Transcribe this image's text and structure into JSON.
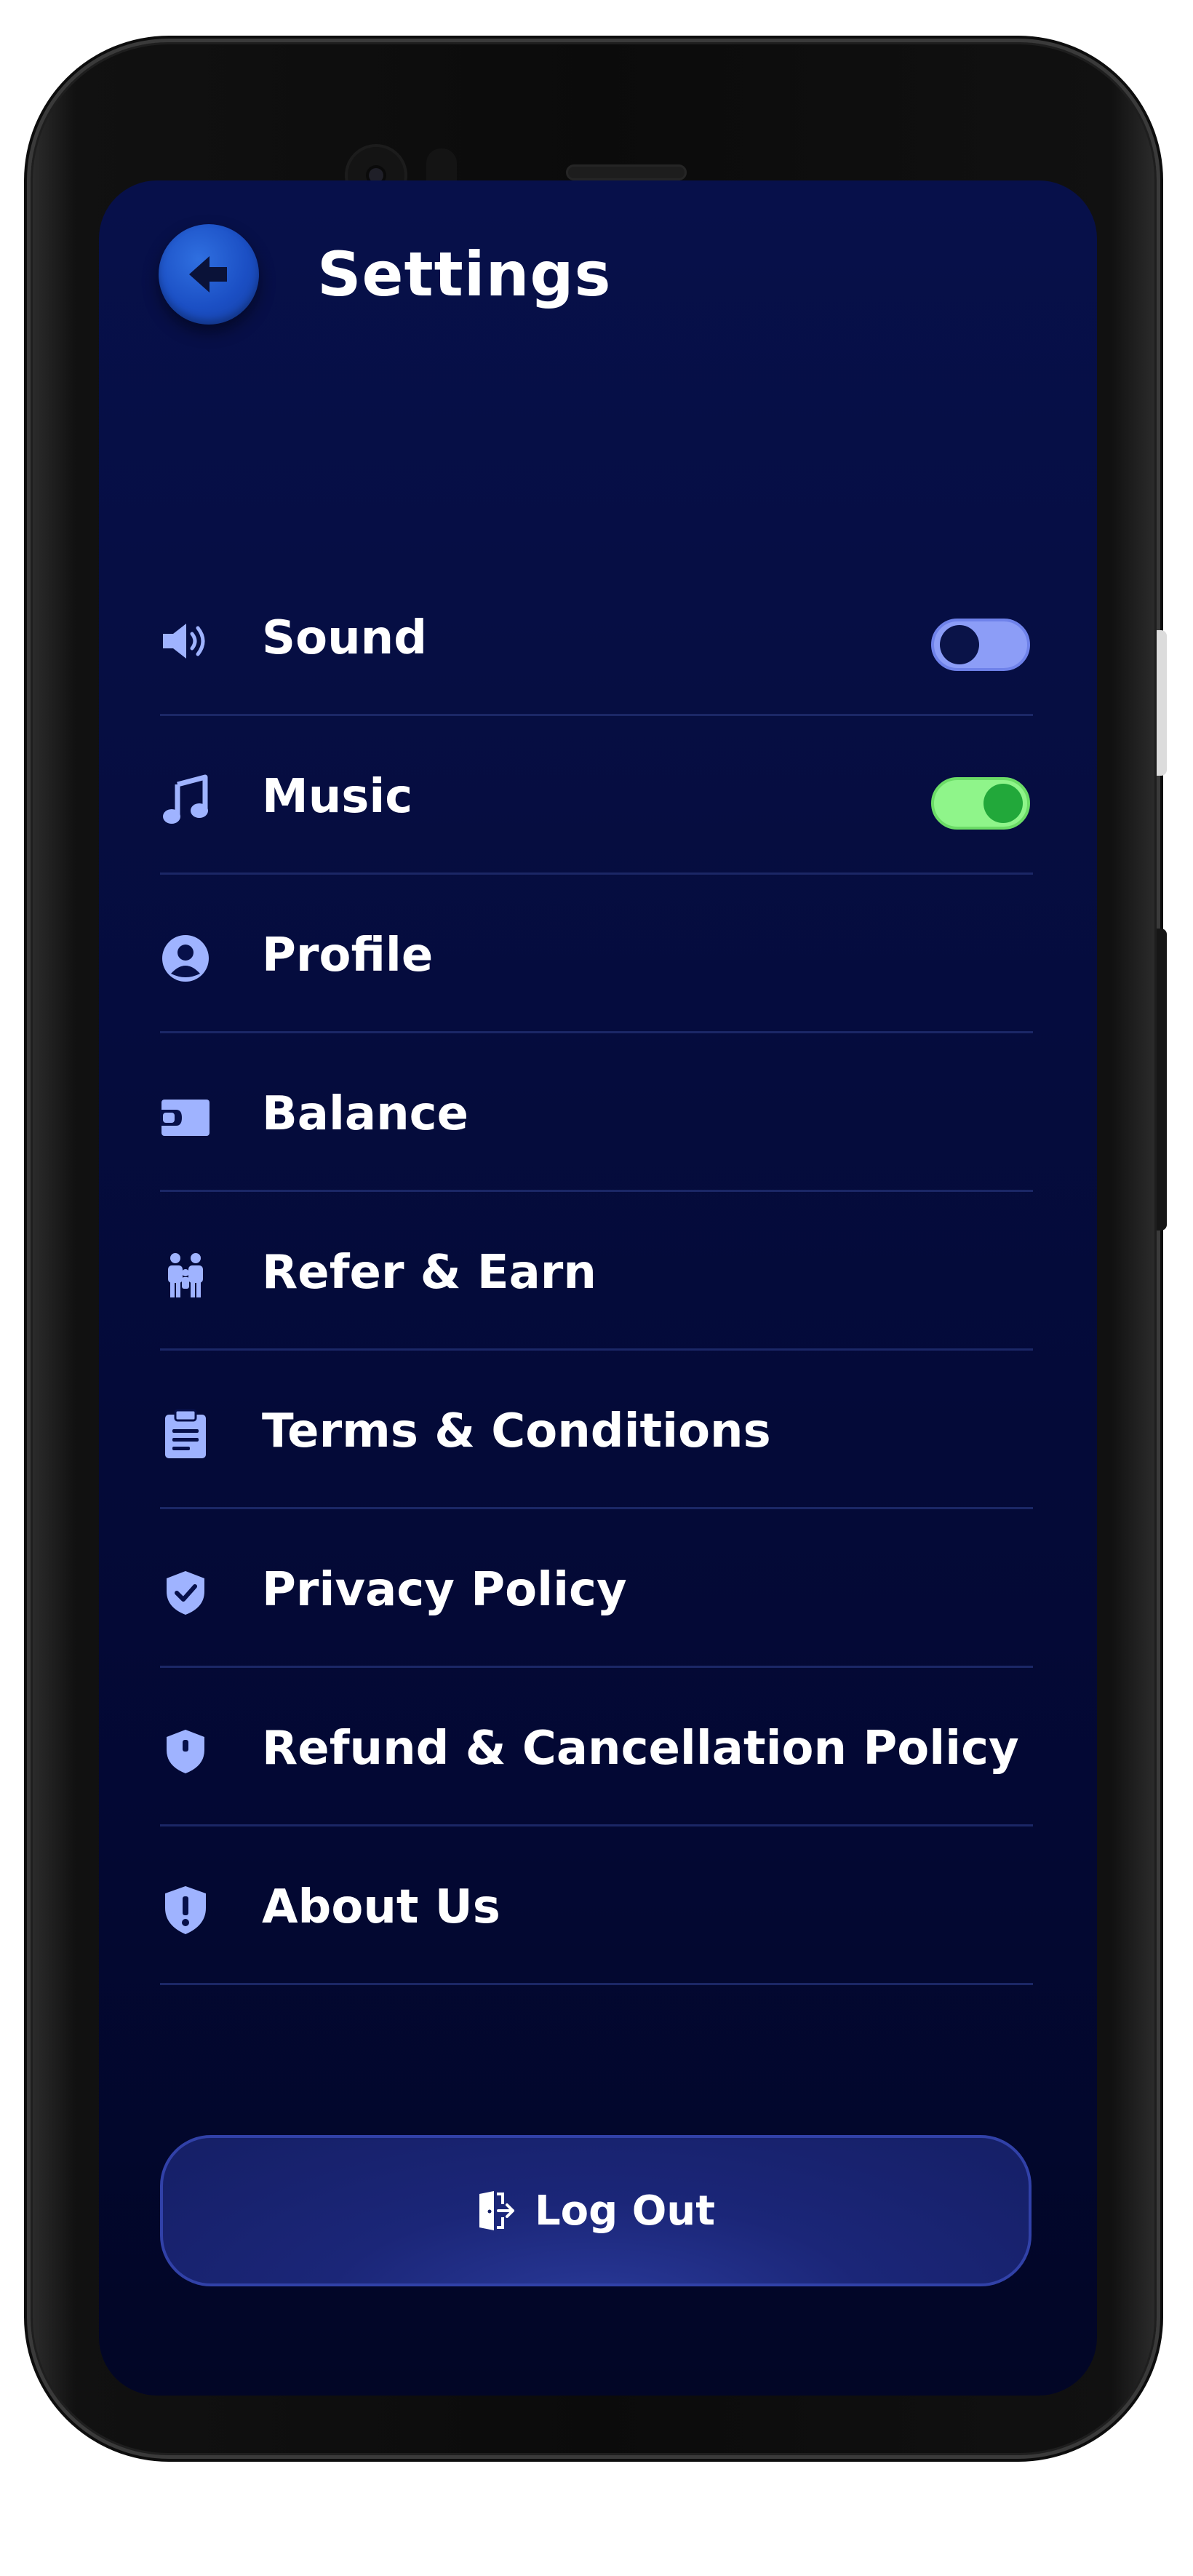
{
  "header": {
    "title": "Settings",
    "back_icon": "arrow-left-icon"
  },
  "settings": [
    {
      "label": "Sound",
      "icon": "speaker-icon",
      "toggle": "off"
    },
    {
      "label": "Music",
      "icon": "music-note-icon",
      "toggle": "on"
    },
    {
      "label": "Profile",
      "icon": "user-circle-icon"
    },
    {
      "label": "Balance",
      "icon": "wallet-icon"
    },
    {
      "label": "Refer & Earn",
      "icon": "people-icon"
    },
    {
      "label": "Terms & Conditions",
      "icon": "clipboard-icon"
    },
    {
      "label": "Privacy Policy",
      "icon": "shield-check-icon"
    },
    {
      "label": "Refund & Cancellation Policy",
      "icon": "shield-icon"
    },
    {
      "label": "About Us",
      "icon": "shield-exclamation-icon"
    }
  ],
  "logout": {
    "label": "Log Out",
    "icon": "door-exit-icon"
  },
  "colors": {
    "background": "#050c3d",
    "accent": "#1b4fc4",
    "icon": "#9fb3ff",
    "toggle_off": "#8c9df7",
    "toggle_on": "#8ff58a",
    "toggle_on_knob": "#22a83a"
  }
}
